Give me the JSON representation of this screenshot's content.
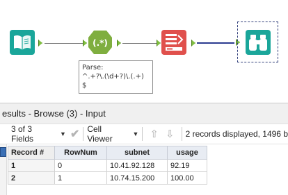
{
  "canvas": {
    "annotation": {
      "title": "Parse:",
      "expression": "^.+?\\.(\\d+?)\\.(.+)",
      "suffix": "$"
    },
    "tools": [
      {
        "name": "input-data",
        "icon": "open-book-icon",
        "color": "#1aa69a"
      },
      {
        "name": "regex",
        "icon": "regex-icon",
        "label": "(.*)",
        "color": "#7fae3f"
      },
      {
        "name": "select",
        "icon": "select-icon",
        "color": "#e0504c"
      },
      {
        "name": "browse",
        "icon": "binoculars-icon",
        "color": "#1aa69a",
        "selected": true
      }
    ],
    "colors": {
      "anchor": "#7fbf3f",
      "connector": "#6e6e6e",
      "connector_selected": "#2b3b8f"
    }
  },
  "results": {
    "title": "esults - Browse (3) - Input",
    "toolbar": {
      "fields_label": "3 of 3 Fields",
      "viewer_label": "Cell Viewer",
      "records_text": "2 records displayed, 1496 b"
    },
    "grid": {
      "headers": [
        "Record #",
        "RowNum",
        "subnet",
        "usage"
      ],
      "rows": [
        [
          "1",
          "0",
          "10.41.92.128",
          "92.19"
        ],
        [
          "2",
          "1",
          "10.74.15.200",
          "100.00"
        ]
      ]
    }
  }
}
